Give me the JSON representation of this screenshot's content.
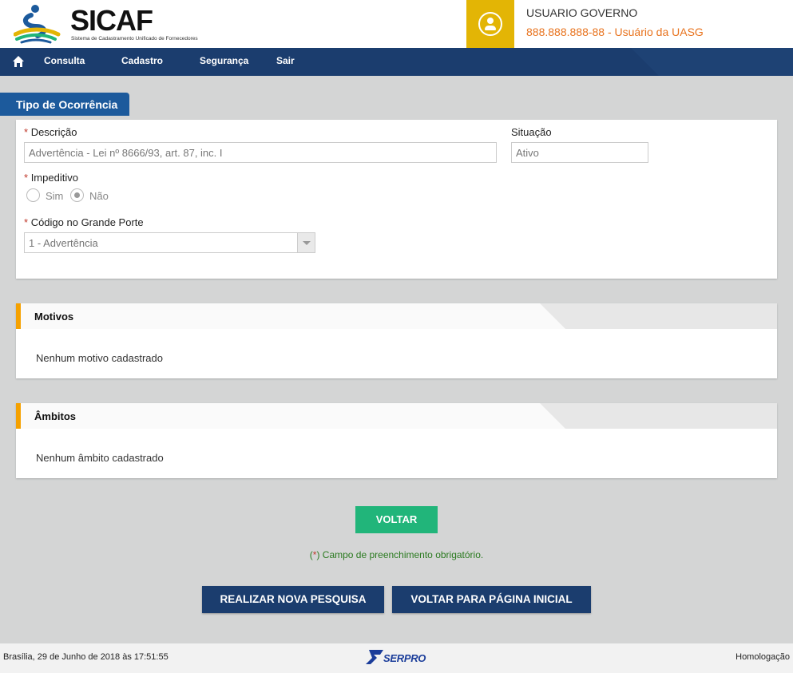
{
  "header": {
    "logo_text": "SICAF",
    "logo_subtitle": "Sistema de Cadastramento Unificado de Fornecedores",
    "user_name": "USUARIO GOVERNO",
    "user_cpf": "888.888.888-88",
    "user_role": " - Usuário da UASG"
  },
  "nav": {
    "items": [
      "Consulta",
      "Cadastro",
      "Segurança",
      "Sair"
    ]
  },
  "section_title": "Tipo de Ocorrência",
  "form": {
    "required_mark": "*",
    "descricao_label": "Descrição",
    "descricao_value": "Advertência - Lei nº 8666/93, art. 87, inc. I",
    "situacao_label": "Situação",
    "situacao_value": "Ativo",
    "impeditivo_label": "Impeditivo",
    "impeditivo_options": [
      "Sim",
      "Não"
    ],
    "impeditivo_selected": "Não",
    "codigo_label": "Código no Grande Porte",
    "codigo_value": "1 - Advertência"
  },
  "motivos": {
    "title": "Motivos",
    "empty_text": "Nenhum motivo cadastrado"
  },
  "ambitos": {
    "title": "Âmbitos",
    "empty_text": "Nenhum âmbito cadastrado"
  },
  "buttons": {
    "voltar": "VOLTAR",
    "nova_pesquisa": "REALIZAR NOVA PESQUISA",
    "pagina_inicial": "VOLTAR PARA PÁGINA INICIAL"
  },
  "required_note": {
    "open": "(",
    "mark": "*",
    "close": ")",
    "text": " Campo de preenchimento obrigatório."
  },
  "footer": {
    "datetime": "Brasília, 29 de Junho de 2018 às 17:51:55",
    "brand": "SERPRO",
    "environment": "Homologação"
  },
  "colors": {
    "nav_bg": "#1b3d6e",
    "accent_yellow": "#e3b505",
    "accent_orange": "#f5a100",
    "tab_blue": "#1c5a9c",
    "voltar_green": "#21b57a"
  }
}
